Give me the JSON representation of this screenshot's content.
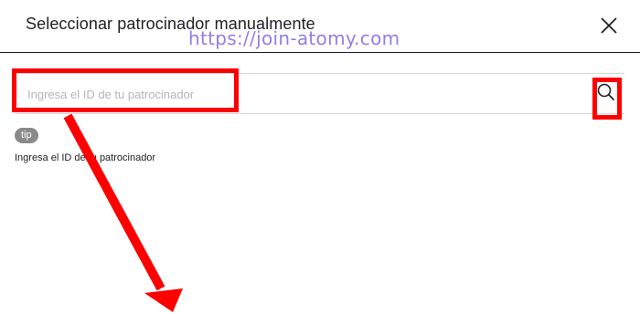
{
  "dialog": {
    "title": "Seleccionar patrocinador manualmente",
    "close_icon": "close-icon"
  },
  "watermark": {
    "text": "https://join-atomy.com",
    "color": "#7b6be0"
  },
  "search": {
    "placeholder": "Ingresa el ID de tu patrocinador",
    "value": "",
    "button_icon": "search-icon"
  },
  "tip": {
    "badge": "tip",
    "text": "Ingresa el ID de tu patrocinador"
  },
  "annotations": {
    "highlight_color": "#ff0000"
  }
}
